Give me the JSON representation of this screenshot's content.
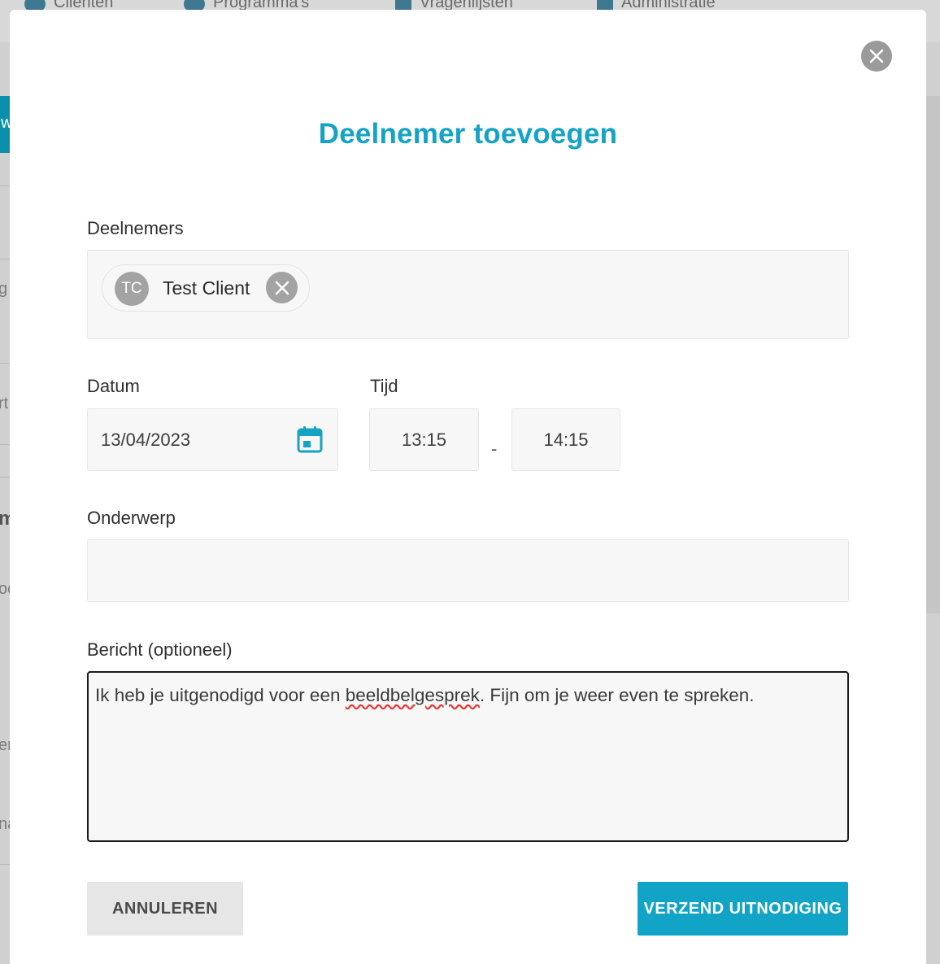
{
  "background": {
    "nav_items": [
      {
        "label": "Cliënten",
        "icon": "people-icon"
      },
      {
        "label": "Programma's",
        "icon": "share-icon"
      },
      {
        "label": "Vragenlijsten",
        "icon": "clipboard-icon"
      },
      {
        "label": "Administratie",
        "icon": "building-icon"
      }
    ],
    "left_fragments": [
      "w",
      "g",
      "rt",
      "m",
      "oc",
      "er",
      "na"
    ]
  },
  "modal": {
    "title": "Deelnemer toevoegen",
    "close_icon": "close-icon",
    "participants": {
      "label": "Deelnemers",
      "chips": [
        {
          "initials": "TC",
          "name": "Test Client"
        }
      ]
    },
    "date": {
      "label": "Datum",
      "value": "13/04/2023",
      "icon": "calendar-icon"
    },
    "time": {
      "label": "Tijd",
      "start": "13:15",
      "separator": "-",
      "end": "14:15"
    },
    "subject": {
      "label": "Onderwerp",
      "value": ""
    },
    "message": {
      "label": "Bericht (optioneel)",
      "text_before": "Ik heb je uitgenodigd voor een ",
      "misspelled_word": "beeldbelgesprek",
      "text_after": ". Fijn om je weer even te spreken."
    },
    "buttons": {
      "cancel": "ANNULEREN",
      "submit": "VERZEND UITNODIGING"
    },
    "colors": {
      "accent": "#14a3c4",
      "button_primary": "#11a4c6",
      "field_background": "#f7f7f7",
      "spellcheck_underline": "#e53935"
    }
  }
}
